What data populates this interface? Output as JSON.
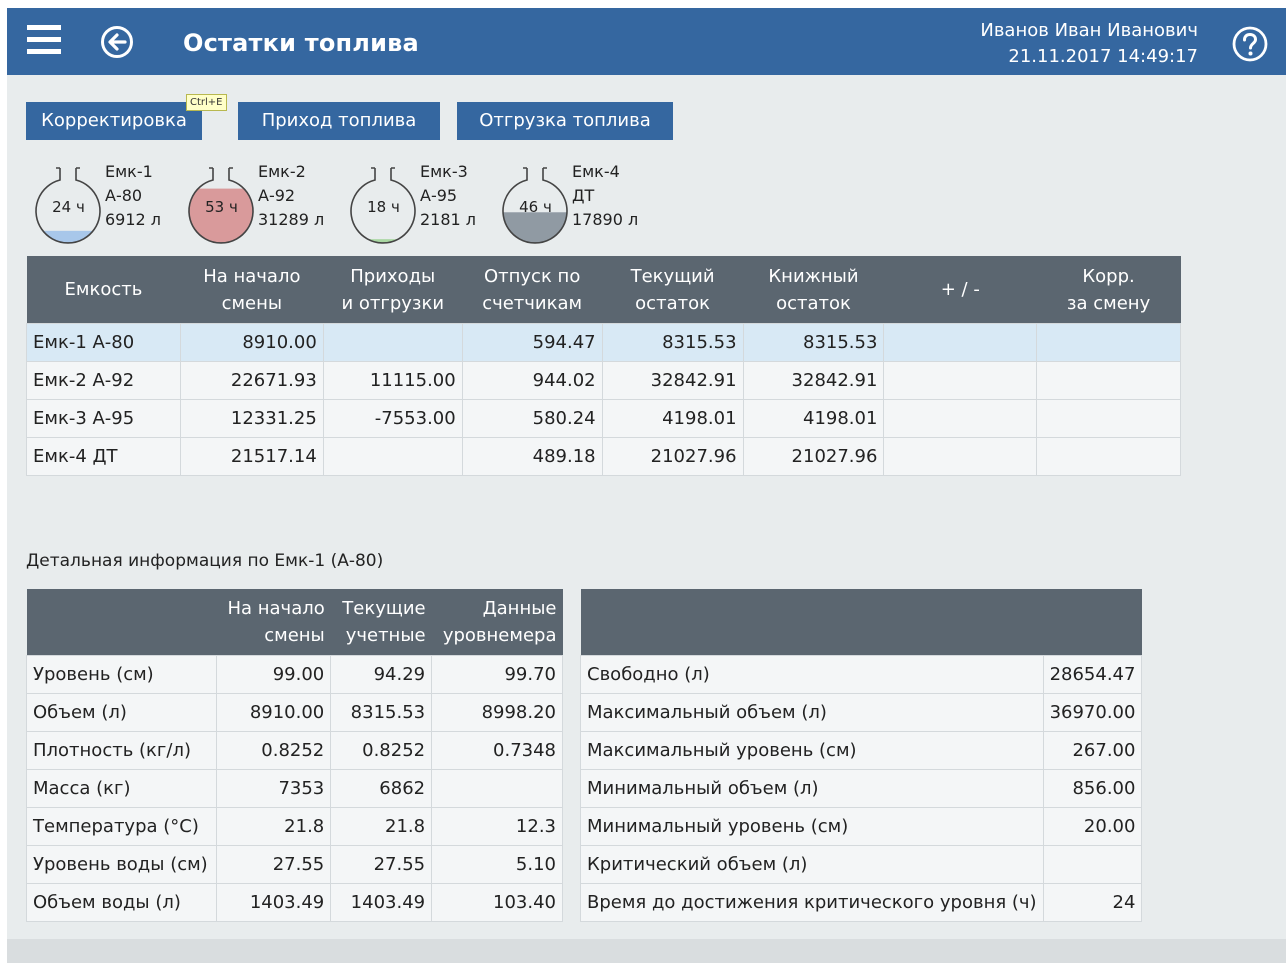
{
  "header": {
    "title": "Остатки топлива",
    "user": "Иванов Иван Иванович",
    "datetime": "21.11.2017 14:49:17",
    "background": "#3567a0"
  },
  "toolbar": {
    "correction_label": "Корректировка",
    "correction_shortcut": "Ctrl+E",
    "receipt_label": "Приход топлива",
    "shipment_label": "Отгрузка топлива"
  },
  "tanks": [
    {
      "name": "Емк-1",
      "fuel": "А-80",
      "volume": "6912 л",
      "hours": "24 ч",
      "color": "#a8c7ea",
      "fill": 0.19
    },
    {
      "name": "Емк-2",
      "fuel": "А-92",
      "volume": "31289 л",
      "hours": "53 ч",
      "color": "#d99a9b",
      "fill": 0.85
    },
    {
      "name": "Емк-3",
      "fuel": "А-95",
      "volume": "2181 л",
      "hours": "18 ч",
      "color": "#a9d7a2",
      "fill": 0.06
    },
    {
      "name": "Емк-4",
      "fuel": "ДТ",
      "volume": "17890 л",
      "hours": "46 ч",
      "color": "#909aa3",
      "fill": 0.48
    }
  ],
  "main_table": {
    "headers": [
      {
        "l1": "Емкость",
        "l2": ""
      },
      {
        "l1": "На начало",
        "l2": "смены"
      },
      {
        "l1": "Приходы",
        "l2": "и отгрузки"
      },
      {
        "l1": "Отпуск по",
        "l2": "счетчикам"
      },
      {
        "l1": "Текущий",
        "l2": "остаток"
      },
      {
        "l1": "Книжный",
        "l2": "остаток"
      },
      {
        "l1": "+ / -",
        "l2": ""
      },
      {
        "l1": "Корр.",
        "l2": "за смену"
      }
    ],
    "rows": [
      {
        "tank": "Емк-1 А-80",
        "start": "8910.00",
        "moves": "",
        "dispensed": "594.47",
        "current": "8315.53",
        "book": "8315.53",
        "diff": "",
        "corr": ""
      },
      {
        "tank": "Емк-2 А-92",
        "start": "22671.93",
        "moves": "11115.00",
        "dispensed": "944.02",
        "current": "32842.91",
        "book": "32842.91",
        "diff": "",
        "corr": ""
      },
      {
        "tank": "Емк-3 А-95",
        "start": "12331.25",
        "moves": "-7553.00",
        "dispensed": "580.24",
        "current": "4198.01",
        "book": "4198.01",
        "diff": "",
        "corr": ""
      },
      {
        "tank": "Емк-4 ДТ",
        "start": "21517.14",
        "moves": "",
        "dispensed": "489.18",
        "current": "21027.96",
        "book": "21027.96",
        "diff": "",
        "corr": ""
      }
    ]
  },
  "detail": {
    "title": "Детальная информация по Емк-1 (А-80)",
    "left_headers": [
      {
        "l1": "На начало",
        "l2": "смены"
      },
      {
        "l1": "Текущие",
        "l2": "учетные"
      },
      {
        "l1": "Данные",
        "l2": "уровнемера"
      }
    ],
    "left_rows": [
      {
        "label": "Уровень (см)",
        "start": "99.00",
        "current": "94.29",
        "gauge": "99.70"
      },
      {
        "label": "Объем (л)",
        "start": "8910.00",
        "current": "8315.53",
        "gauge": "8998.20"
      },
      {
        "label": "Плотность (кг/л)",
        "start": "0.8252",
        "current": "0.8252",
        "gauge": "0.7348"
      },
      {
        "label": "Масса (кг)",
        "start": "7353",
        "current": "6862",
        "gauge": ""
      },
      {
        "label": "Температура (°С)",
        "start": "21.8",
        "current": "21.8",
        "gauge": "12.3"
      },
      {
        "label": "Уровень воды (см)",
        "start": "27.55",
        "current": "27.55",
        "gauge": "5.10"
      },
      {
        "label": "Объем воды (л)",
        "start": "1403.49",
        "current": "1403.49",
        "gauge": "103.40"
      }
    ],
    "right_rows": [
      {
        "label": "Свободно (л)",
        "value": "28654.47"
      },
      {
        "label": "Максимальный объем (л)",
        "value": "36970.00"
      },
      {
        "label": "Максимальный уровень (см)",
        "value": "267.00"
      },
      {
        "label": "Минимальный объем (л)",
        "value": "856.00"
      },
      {
        "label": "Минимальный уровень (см)",
        "value": "20.00"
      },
      {
        "label": "Критический объем (л)",
        "value": ""
      },
      {
        "label": "Время до достижения критического уровня (ч)",
        "value": "24"
      }
    ]
  }
}
